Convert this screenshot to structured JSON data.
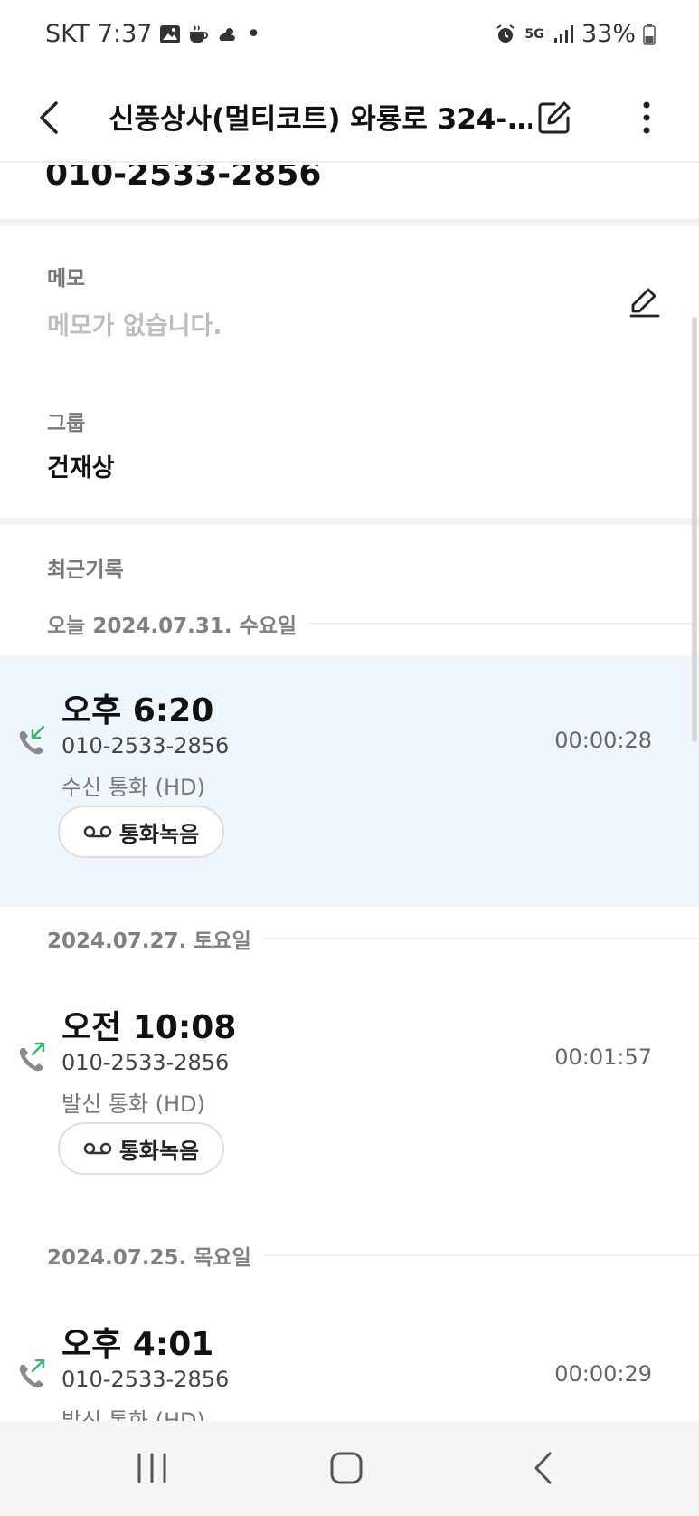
{
  "status_bar": {
    "carrier_time": "SKT 7:37",
    "dot": "•",
    "network": "5G",
    "battery": "33%"
  },
  "app_bar": {
    "title": "신풍상사(멀티코트) 와룡로 324-…"
  },
  "contact": {
    "phone": "010-2533-2856"
  },
  "memo": {
    "label": "메모",
    "value": "메모가 없습니다."
  },
  "group": {
    "label": "그룹",
    "value": "건재상"
  },
  "recent": {
    "title": "최근기록",
    "dates": [
      {
        "label": "오늘 2024.07.31. 수요일"
      },
      {
        "label": "2024.07.27. 토요일"
      },
      {
        "label": "2024.07.25. 목요일"
      }
    ],
    "calls": [
      {
        "time": "오후 6:20",
        "number": "010-2533-2856",
        "type": "수신 통화 (HD)",
        "duration": "00:00:28",
        "direction": "incoming",
        "recording_label": "통화녹음"
      },
      {
        "time": "오전 10:08",
        "number": "010-2533-2856",
        "type": "발신 통화 (HD)",
        "duration": "00:01:57",
        "direction": "outgoing",
        "recording_label": "통화녹음"
      },
      {
        "time": "오후 4:01",
        "number": "010-2533-2856",
        "type": "발신 통화 (HD)",
        "duration": "00:00:29",
        "direction": "outgoing"
      }
    ]
  },
  "colors": {
    "highlight_bg": "#eef5fc",
    "call_arrow": "#3cb371",
    "phone_icon": "#8a8a8a"
  }
}
